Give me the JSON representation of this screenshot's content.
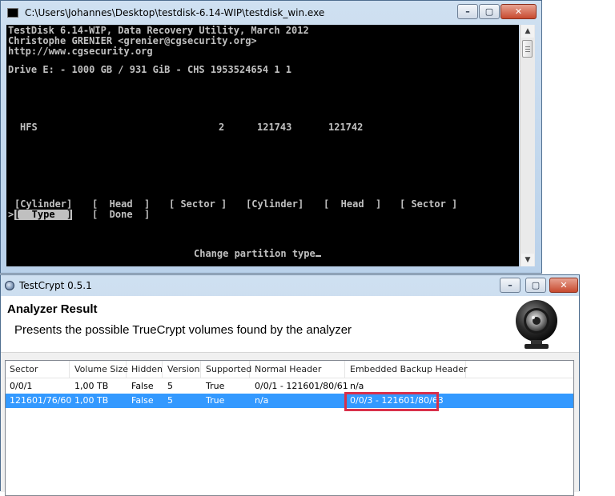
{
  "console": {
    "title": "C:\\Users\\Johannes\\Desktop\\testdisk-6.14-WIP\\testdisk_win.exe",
    "header_line1": "TestDisk 6.14-WIP, Data Recovery Utility, March 2012",
    "header_line2": "Christophe GRENIER <grenier@cgsecurity.org>",
    "header_line3": "http://www.cgsecurity.org",
    "drive_line": "Drive E: - 1000 GB / 931 GiB - CHS 1953524654 1 1",
    "partition": {
      "type": "HFS",
      "start_cyl": "2",
      "end_cyl": "121743",
      "size": "121742"
    },
    "menu_row1": {
      "cyl1": "[Cylinder]",
      "head1": "[  Head  ]",
      "sector1": "[ Sector ]",
      "cyl2": "[Cylinder]",
      "head2": "[  Head  ]",
      "sector2": "[ Sector ]"
    },
    "menu_row2": {
      "type": "[  Type  ]",
      "done": "[  Done  ]",
      "pointer": ">"
    },
    "status": "Change partition type"
  },
  "testcrypt": {
    "title": "TestCrypt 0.5.1",
    "heading": "Analyzer Result",
    "subtitle": "Presents the possible TrueCrypt volumes found by the analyzer",
    "columns": [
      "Sector",
      "Volume Size",
      "Hidden",
      "Version",
      "Supported",
      "Normal Header",
      "Embedded Backup Header"
    ],
    "rows": [
      [
        "0/0/1",
        "1,00 TB",
        "False",
        "5",
        "True",
        "0/0/1 - 121601/80/61",
        "n/a"
      ],
      [
        "121601/76/60",
        "1,00 TB",
        "False",
        "5",
        "True",
        "n/a",
        "0/0/3 - 121601/80/63"
      ]
    ],
    "selected_row": 1
  },
  "caption_buttons": {
    "minimize": "–",
    "maximize": "▢",
    "close": "✕"
  },
  "icons": {
    "console": "cmd-icon",
    "testcrypt": "lock-icon",
    "header_logo": "webcam-icon",
    "scroll_up": "arrow-up-icon",
    "scroll_down": "arrow-down-icon"
  },
  "colors": {
    "selection": "#3399ff",
    "highlight_box": "#d9304a",
    "console_bg": "#000000",
    "console_text": "#c0c0c0"
  }
}
